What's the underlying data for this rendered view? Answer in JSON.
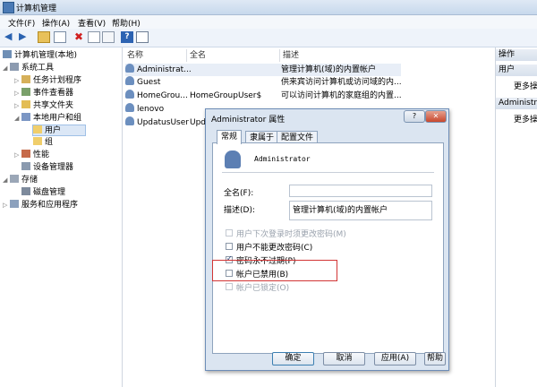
{
  "window": {
    "title": "计算机管理"
  },
  "menu": [
    "文件(F)",
    "操作(A)",
    "查看(V)",
    "帮助(H)"
  ],
  "tree": {
    "root": "计算机管理(本地)",
    "items": [
      {
        "label": "系统工具"
      },
      {
        "label": "任务计划程序"
      },
      {
        "label": "事件查看器"
      },
      {
        "label": "共享文件夹"
      },
      {
        "label": "本地用户和组"
      },
      {
        "label": "用户"
      },
      {
        "label": "组"
      },
      {
        "label": "性能"
      },
      {
        "label": "设备管理器"
      },
      {
        "label": "存储"
      },
      {
        "label": "磁盘管理"
      },
      {
        "label": "服务和应用程序"
      }
    ]
  },
  "list": {
    "headers": {
      "name": "名称",
      "fullname": "全名",
      "desc": "描述"
    },
    "rows": [
      {
        "name": "Administrat...",
        "fullname": "",
        "desc": "管理计算机(域)的内置帐户"
      },
      {
        "name": "Guest",
        "fullname": "",
        "desc": "供来宾访问计算机或访问域的内..."
      },
      {
        "name": "HomeGrou...",
        "fullname": "HomeGroupUser$",
        "desc": "可以访问计算机的家庭组的内置..."
      },
      {
        "name": "lenovo",
        "fullname": "",
        "desc": ""
      },
      {
        "name": "UpdatusUser",
        "fullname": "Upd",
        "desc": ""
      }
    ]
  },
  "actions": {
    "header": "操作",
    "sections": [
      {
        "title": "用户",
        "more": "更多操"
      },
      {
        "title": "Administra...",
        "more": "更多操"
      }
    ]
  },
  "dialog": {
    "title": "Administrator 属性",
    "help": "?",
    "close": "✕",
    "tabs": [
      "常规",
      "隶属于",
      "配置文件"
    ],
    "username": "Administrator",
    "fullname_label": "全名(F):",
    "fullname_value": "",
    "desc_label": "描述(D):",
    "desc_value": "管理计算机(域)的内置帐户",
    "options": [
      {
        "label": "用户下次登录时须更改密码(M)",
        "checked": false,
        "disabled": true
      },
      {
        "label": "用户不能更改密码(C)",
        "checked": false,
        "disabled": false
      },
      {
        "label": "密码永不过期(P)",
        "checked": true,
        "disabled": false
      },
      {
        "label": "帐户已禁用(B)",
        "checked": false,
        "disabled": false
      },
      {
        "label": "帐户已锁定(O)",
        "checked": false,
        "disabled": true
      }
    ],
    "buttons": {
      "ok": "确定",
      "cancel": "取消",
      "apply": "应用(A)",
      "help": "帮助"
    }
  },
  "colors": {
    "accent": "#3c7fb1",
    "highlight": "#d23535"
  }
}
